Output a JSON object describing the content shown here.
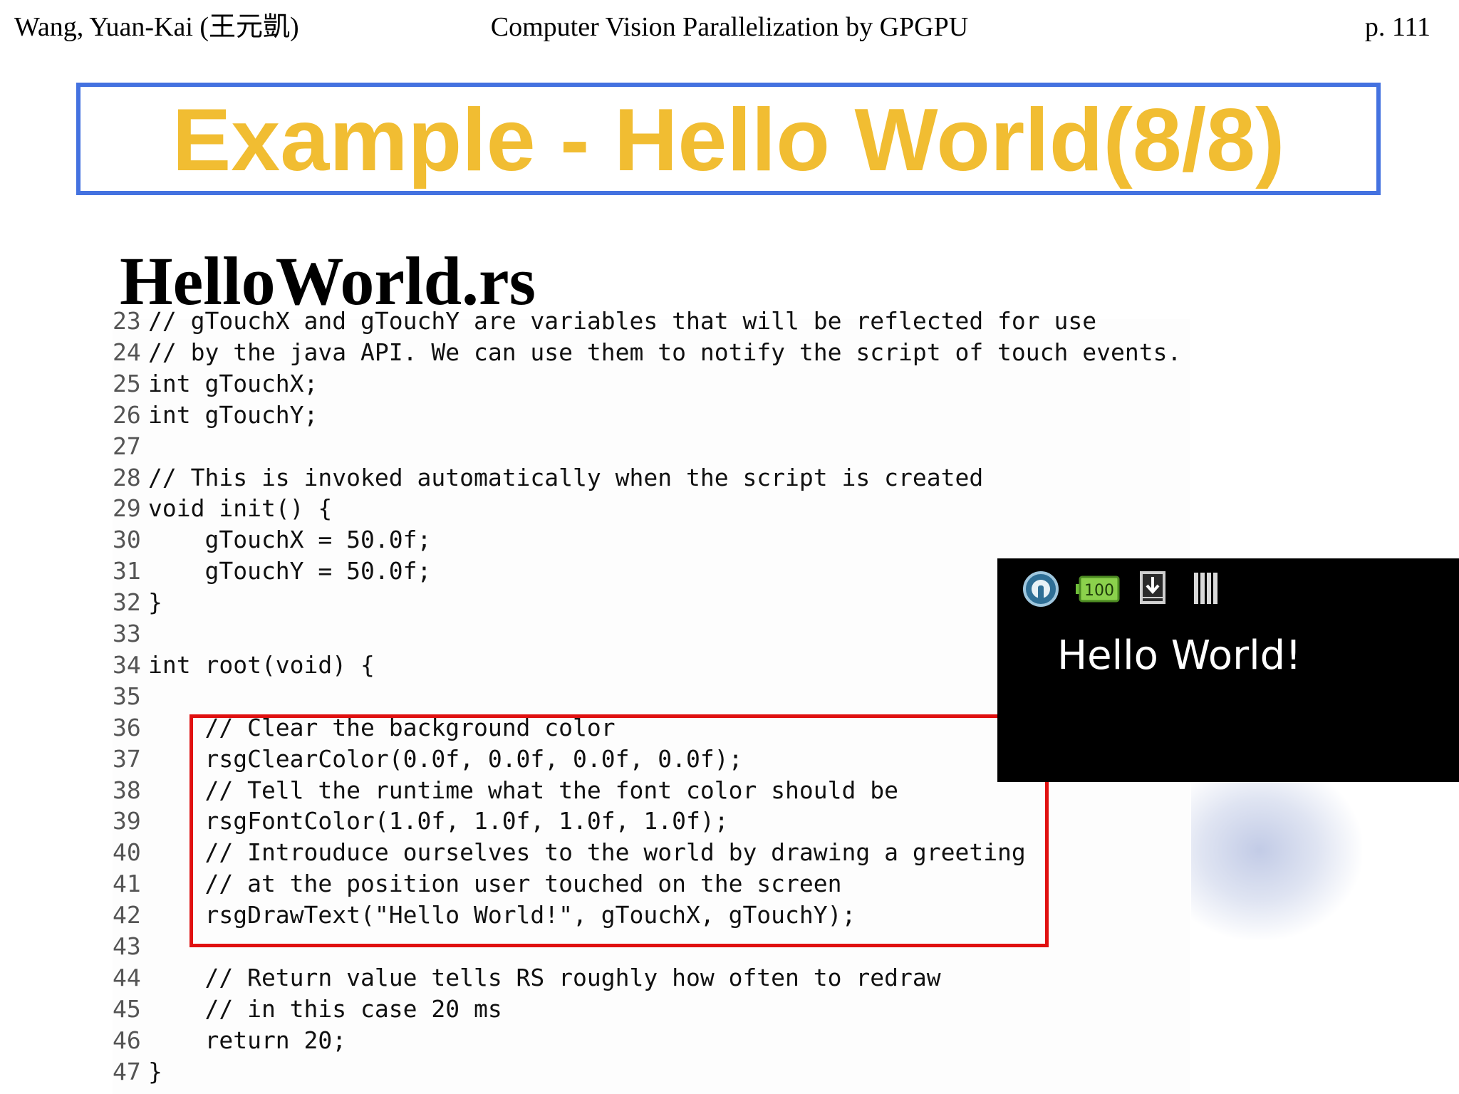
{
  "header": {
    "author": "Wang, Yuan-Kai (王元凱)",
    "course": "Computer Vision Parallelization by GPGPU",
    "page": "p. 111"
  },
  "slide": {
    "title": "Example - Hello World(8/8)",
    "filename": "HelloWorld.rs"
  },
  "code": {
    "lines": [
      {
        "n": "23",
        "text": "// gTouchX and gTouchY are variables that will be reflected for use"
      },
      {
        "n": "24",
        "text": "// by the java API. We can use them to notify the script of touch events."
      },
      {
        "n": "25",
        "text": "int gTouchX;"
      },
      {
        "n": "26",
        "text": "int gTouchY;"
      },
      {
        "n": "27",
        "text": ""
      },
      {
        "n": "28",
        "text": "// This is invoked automatically when the script is created"
      },
      {
        "n": "29",
        "text": "void init() {"
      },
      {
        "n": "30",
        "text": "    gTouchX = 50.0f;"
      },
      {
        "n": "31",
        "text": "    gTouchY = 50.0f;"
      },
      {
        "n": "32",
        "text": "}"
      },
      {
        "n": "33",
        "text": ""
      },
      {
        "n": "34",
        "text": "int root(void) {"
      },
      {
        "n": "35",
        "text": ""
      },
      {
        "n": "36",
        "text": "    // Clear the background color"
      },
      {
        "n": "37",
        "text": "    rsgClearColor(0.0f, 0.0f, 0.0f, 0.0f);"
      },
      {
        "n": "38",
        "text": "    // Tell the runtime what the font color should be"
      },
      {
        "n": "39",
        "text": "    rsgFontColor(1.0f, 1.0f, 1.0f, 1.0f);"
      },
      {
        "n": "40",
        "text": "    // Introuduce ourselves to the world by drawing a greeting"
      },
      {
        "n": "41",
        "text": "    // at the position user touched on the screen"
      },
      {
        "n": "42",
        "text": "    rsgDrawText(\"Hello World!\", gTouchX, gTouchY);"
      },
      {
        "n": "43",
        "text": ""
      },
      {
        "n": "44",
        "text": "    // Return value tells RS roughly how often to redraw"
      },
      {
        "n": "45",
        "text": "    // in this case 20 ms"
      },
      {
        "n": "46",
        "text": "    return 20;"
      },
      {
        "n": "47",
        "text": "}"
      }
    ]
  },
  "device": {
    "battery_level": "100",
    "hello_text": "Hello World!",
    "icons": [
      "android-debug-icon",
      "battery-icon",
      "download-icon",
      "signal-bars-icon"
    ]
  },
  "colors": {
    "title": "#f1bd32",
    "title_border": "#4472e0",
    "highlight_border": "#e01010"
  }
}
